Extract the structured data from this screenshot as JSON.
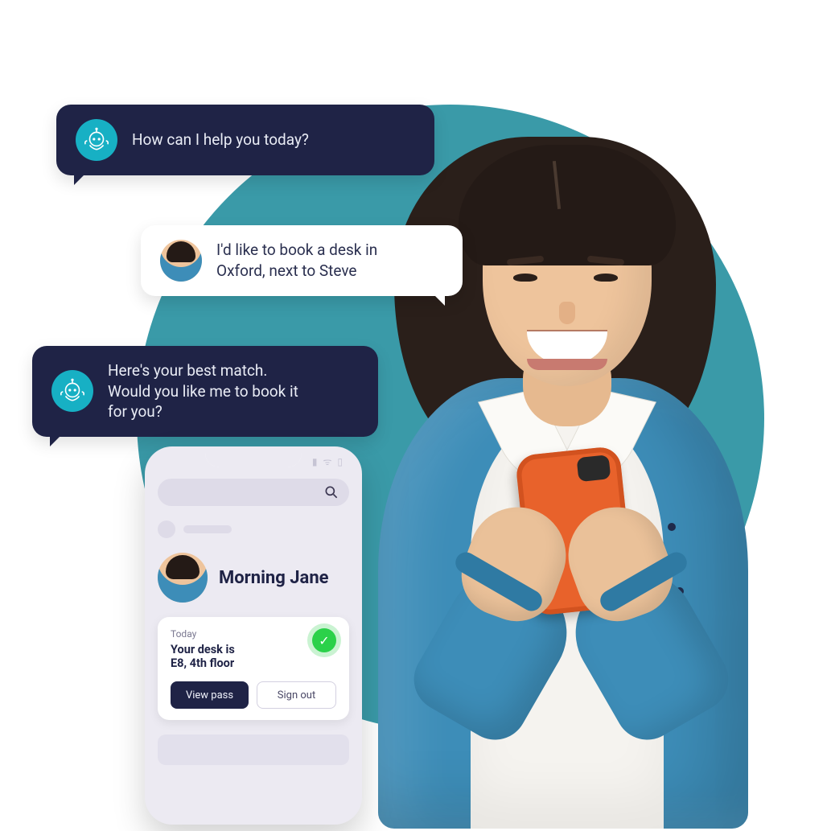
{
  "chat": {
    "bot1": "How can I help you  today?",
    "user1_line1": "I'd like to book a desk in",
    "user1_line2": "Oxford, next to Steve",
    "bot2_line1": "Here's your best match.",
    "bot2_line2": "Would you like me to book it",
    "bot2_line3": "for you?"
  },
  "phone": {
    "greeting": "Morning Jane",
    "card": {
      "subtitle": "Today",
      "title_line1": "Your desk is",
      "title_line2": "E8, 4th floor",
      "primary": "View pass",
      "secondary": "Sign out"
    }
  },
  "icons": {
    "bot": "bot-icon",
    "search": "search-icon",
    "check": "check-icon"
  },
  "colors": {
    "bubble_bot_bg": "#1f2346",
    "bubble_user_bg": "#ffffff",
    "accent_teal": "#17b0c4",
    "bg_circle": "#3a9aa8",
    "success": "#2bd14a",
    "cardigan": "#3d8db8",
    "phone_case": "#e8622b"
  }
}
